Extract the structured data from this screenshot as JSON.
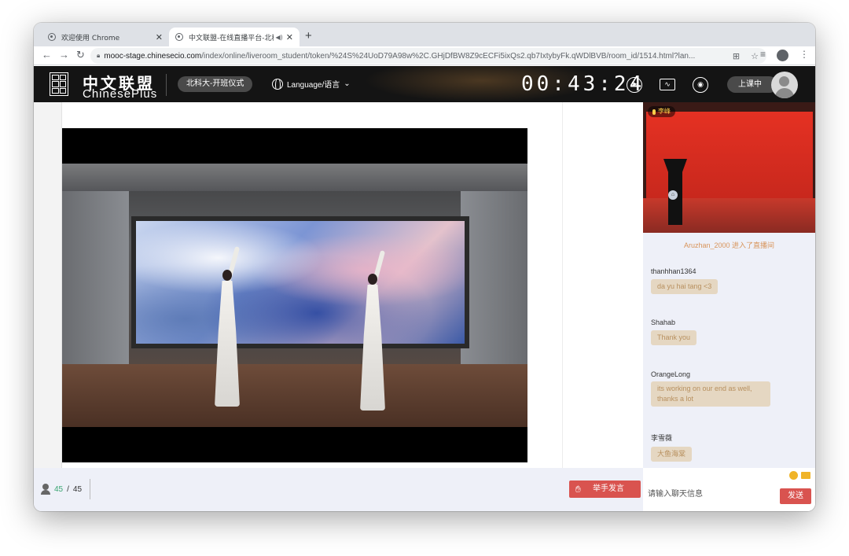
{
  "browser": {
    "tabs": [
      {
        "title": "欢迎使用 Chrome"
      },
      {
        "title": "中文联盟-在线直播平台-北科"
      }
    ],
    "url_host": "mooc-stage.chinesecio.com",
    "url_path": "/index/online/liveroom_student/token/%24S%24UoD79A98w%2C.GHjDfBW8Z9cECFi5ixQs2.qb7IxtybyFk.qWDlBVB/room_id/1514.html?lan..."
  },
  "header": {
    "logo_cn": "中文联盟",
    "logo_en": "ChinesePlus",
    "course": "北科大-开班仪式",
    "language": "Language/语言",
    "timer": "00:43:24",
    "status": "上课中"
  },
  "camera": {
    "speaker": "李峰"
  },
  "chat": {
    "system_message": "Aruzhan_2000 进入了直播间",
    "messages": [
      {
        "user": "thanhhan1364",
        "text": "da yu hai tang <3"
      },
      {
        "user": "Shahab",
        "text": "Thank you"
      },
      {
        "user": "OrangeLong",
        "text": "its working on our end as well, thanks a lot"
      },
      {
        "user": "李雪薇",
        "text": "大鱼海棠"
      }
    ],
    "input_placeholder": "请输入聊天信息",
    "send_label": "发送"
  },
  "bottom": {
    "online": "45",
    "total": "45",
    "raise_hand_label": "举手发言"
  }
}
